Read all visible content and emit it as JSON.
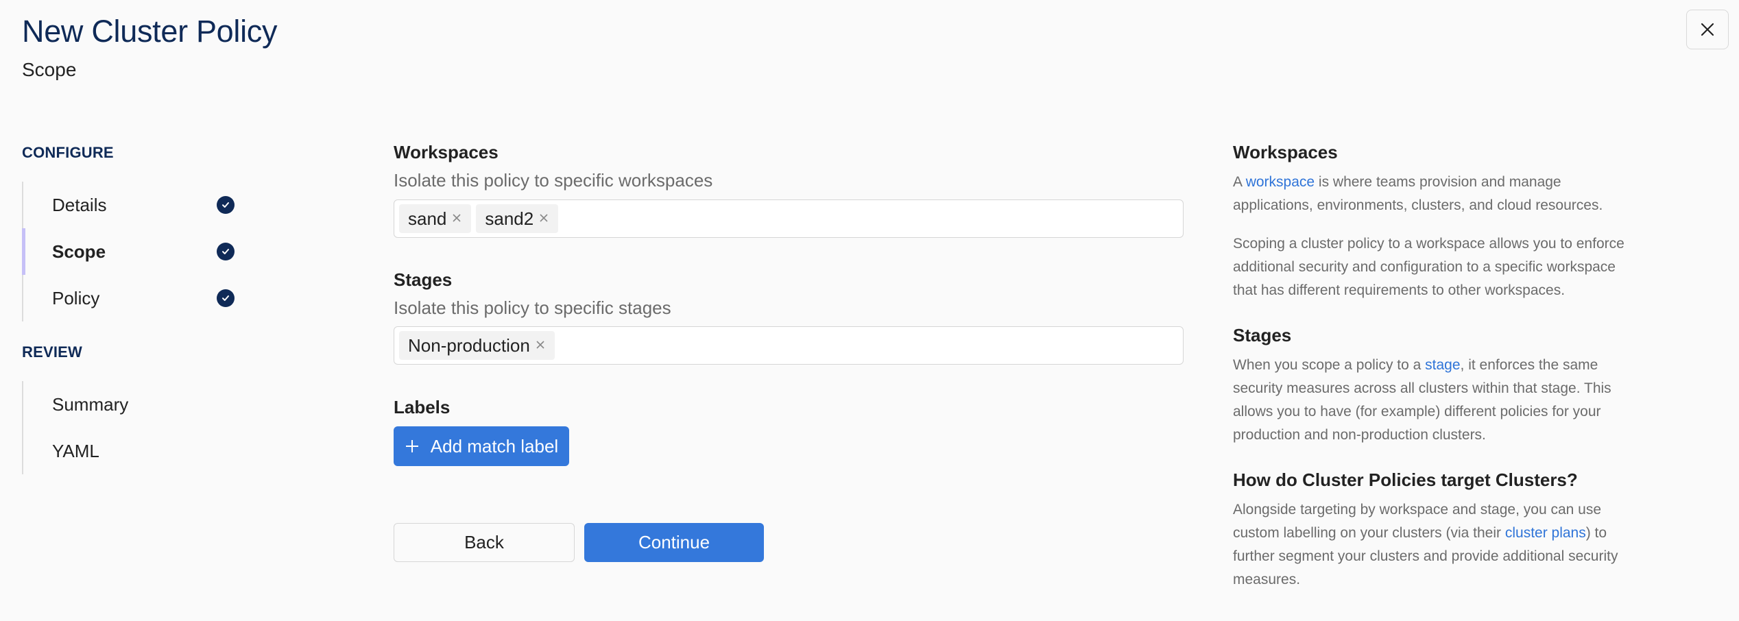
{
  "header": {
    "title": "New Cluster Policy",
    "subtitle": "Scope",
    "close_icon": "close-icon"
  },
  "sidebar": {
    "sections": [
      {
        "title": "CONFIGURE",
        "items": [
          {
            "label": "Details",
            "completed": true,
            "active": false
          },
          {
            "label": "Scope",
            "completed": true,
            "active": true
          },
          {
            "label": "Policy",
            "completed": true,
            "active": false
          }
        ]
      },
      {
        "title": "REVIEW",
        "items": [
          {
            "label": "Summary",
            "completed": false,
            "active": false
          },
          {
            "label": "YAML",
            "completed": false,
            "active": false
          }
        ]
      }
    ]
  },
  "form": {
    "workspaces": {
      "label": "Workspaces",
      "help": "Isolate this policy to specific workspaces",
      "tags": [
        "sand",
        "sand2"
      ]
    },
    "stages": {
      "label": "Stages",
      "help": "Isolate this policy to specific stages",
      "tags": [
        "Non-production"
      ]
    },
    "labels": {
      "label": "Labels",
      "add_button": "Add match label"
    },
    "back_button": "Back",
    "continue_button": "Continue"
  },
  "help_panel": {
    "workspaces": {
      "heading": "Workspaces",
      "p1_pre": "A ",
      "p1_link": "workspace",
      "p1_post": " is where teams provision and manage applications, environments, clusters, and cloud resources.",
      "p2": "Scoping a cluster policy to a workspace allows you to enforce additional security and configuration to a specific workspace that has different requirements to other workspaces."
    },
    "stages": {
      "heading": "Stages",
      "p1_pre": "When you scope a policy to a ",
      "p1_link": "stage",
      "p1_post": ", it enforces the same security measures across all clusters within that stage. This allows you to have (for example) different policies for your production and non-production clusters."
    },
    "targeting": {
      "heading": "How do Cluster Policies target Clusters?",
      "p1_pre": "Alongside targeting by workspace and stage, you can use custom labelling on your clusters (via their ",
      "p1_link": "cluster plans",
      "p1_post": ") to further segment your clusters and provide additional security measures."
    }
  },
  "colors": {
    "primary": "#3478db",
    "navy": "#0f2a57",
    "active_indicator": "#c6c0f7",
    "link": "#2f74d8"
  }
}
